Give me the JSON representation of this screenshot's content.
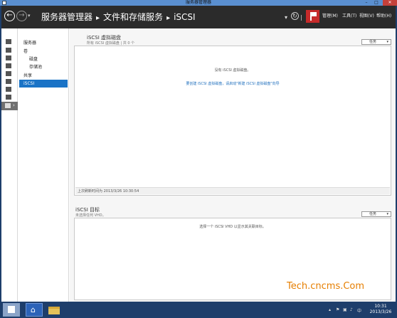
{
  "titlebar": {
    "title": "服务器管理器",
    "minimize": "–",
    "maximize": "□",
    "close": "✕"
  },
  "header": {
    "back_glyph": "←",
    "forward_glyph": "→",
    "dropdown_glyph": "▾",
    "breadcrumb": [
      "服务器管理器",
      "文件和存储服务",
      "iSCSI"
    ],
    "breadcrumb_sep": "▸",
    "refresh_glyph": "↻",
    "refresh_arrow": "▾",
    "menus": [
      "管理(M)",
      "工具(T)",
      "视图(V)",
      "帮助(H)"
    ],
    "accent": "#c62a2a"
  },
  "nav_panel": {
    "items": [
      {
        "label": "服务器",
        "level": 0,
        "selected": false
      },
      {
        "label": "卷",
        "level": 0,
        "selected": false
      },
      {
        "label": "磁盘",
        "level": 1,
        "selected": false
      },
      {
        "label": "存储池",
        "level": 1,
        "selected": false
      },
      {
        "label": "共享",
        "level": 0,
        "selected": false
      },
      {
        "label": "iSCSI",
        "level": 0,
        "selected": true
      }
    ],
    "selected_color": "#1a73c6"
  },
  "iscsi_disks": {
    "title": "iSCSI 虚拟磁盘",
    "subtitle": "所有 iSCSI 虚拟磁盘 | 共 0 个",
    "tasks_label": "任务",
    "empty_message": "没有 iSCSI 虚拟磁盘。",
    "create_link": "要创建 iSCSI 虚拟磁盘，请启动\"新建 iSCSI 虚拟磁盘\"向导",
    "footer": "上次刷新时间为 2013/3/26 10:30:54"
  },
  "iscsi_targets": {
    "title": "iSCSI 目标",
    "subtitle": "未选择任何 VHD。",
    "tasks_label": "任务",
    "empty_message": "选择一个 iSCSI VHD 以显示其关联目标。"
  },
  "watermark": "Tech.cncms.Com",
  "taskbar": {
    "app_glyph": "⌂",
    "tray_icons": [
      "▴",
      "⚑",
      "▣",
      "♪",
      "中"
    ],
    "clock_time": "10:31",
    "clock_date": "2013/3/26"
  }
}
